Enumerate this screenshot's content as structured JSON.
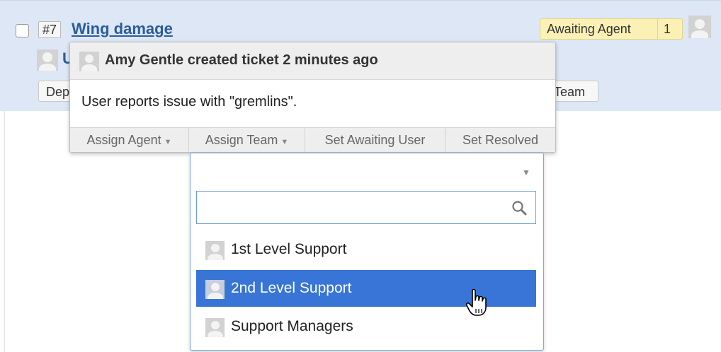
{
  "ticket": {
    "number": "#7",
    "title": "Wing damage",
    "status": {
      "label": "Awaiting Agent",
      "count": "1"
    },
    "behind_visible": {
      "requester_initial": "U",
      "department_fragment": "Dep",
      "team_fragment": "Team"
    }
  },
  "popover": {
    "header": "Amy Gentle created ticket 2 minutes ago",
    "message": "User reports issue with \"gremlins\".",
    "actions": [
      "Assign Agent",
      "Assign Team",
      "Set Awaiting User",
      "Set Resolved"
    ]
  },
  "team_dropdown": {
    "selected": "",
    "search_value": "",
    "options": [
      {
        "label": "1st Level Support",
        "highlighted": false
      },
      {
        "label": "2nd Level Support",
        "highlighted": true
      },
      {
        "label": "Support Managers",
        "highlighted": false
      }
    ]
  },
  "colors": {
    "row_background": "#dde7f6",
    "link": "#2b5d9c",
    "status_badge": "#fbf1b5",
    "highlight": "#3875d7"
  },
  "icons": [
    "avatar-icon",
    "search-icon",
    "caret-down-icon",
    "hand-cursor-icon"
  ]
}
